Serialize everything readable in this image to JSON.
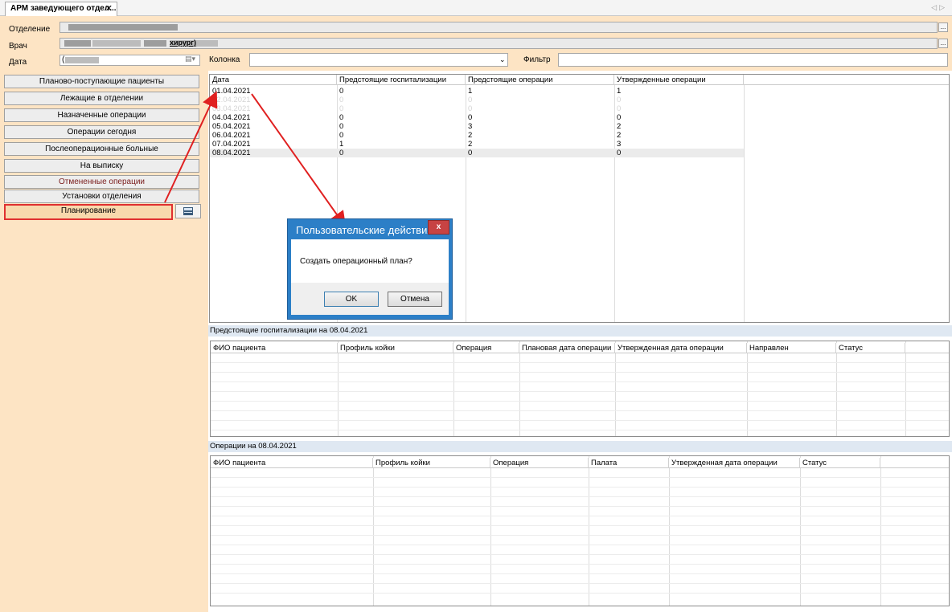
{
  "tab": {
    "title": "АРМ заведующего отдел...",
    "close": "✕"
  },
  "form": {
    "department_label": "Отделение",
    "doctor_label": "Врач",
    "doctor_suffix": "хирург)",
    "date_label": "Дата",
    "date_value": "(",
    "column_label": "Колонка",
    "filter_label": "Фильтр"
  },
  "nav": {
    "items": [
      "Планово-поступающие пациенты",
      "Лежащие в отделении",
      "Назначенные операции",
      "Операции сегодня",
      "Послеоперационные больные",
      "На выписку",
      "Отмененные операции",
      "Установки отделения",
      "Планирование"
    ]
  },
  "summary_grid": {
    "headers": [
      "Дата",
      "Предстоящие госпитализации",
      "Предстоящие операции",
      "Утвержденные операции"
    ],
    "rows": [
      [
        "01.04.2021",
        "0",
        "1",
        "1"
      ],
      [
        "02.04.2021",
        "0",
        "0",
        "0"
      ],
      [
        "03.04.2021",
        "0",
        "0",
        "0"
      ],
      [
        "04.04.2021",
        "0",
        "0",
        "0"
      ],
      [
        "05.04.2021",
        "0",
        "3",
        "2"
      ],
      [
        "06.04.2021",
        "0",
        "2",
        "2"
      ],
      [
        "07.04.2021",
        "1",
        "2",
        "3"
      ],
      [
        "08.04.2021",
        "0",
        "0",
        "0"
      ]
    ]
  },
  "hosp_section": {
    "title": "Предстоящие госпитализации на 08.04.2021",
    "headers": [
      "ФИО пациента",
      "Профиль койки",
      "Операция",
      "Плановая дата операции",
      "Утвержденная дата операции",
      "Направлен",
      "Статус"
    ]
  },
  "ops_section": {
    "title": "Операции на 08.04.2021",
    "headers": [
      "ФИО пациента",
      "Профиль койки",
      "Операция",
      "Палата",
      "Утвержденная дата операции",
      "Статус"
    ]
  },
  "dialog": {
    "title": "Пользовательские действия",
    "close": "x",
    "message": "Создать операционный план?",
    "ok_label": "OK",
    "cancel_label": "Отмена"
  },
  "colors": {
    "panel": "#fde4c4",
    "highlight": "#e03030",
    "dialog_title": "#2c7fc7"
  }
}
